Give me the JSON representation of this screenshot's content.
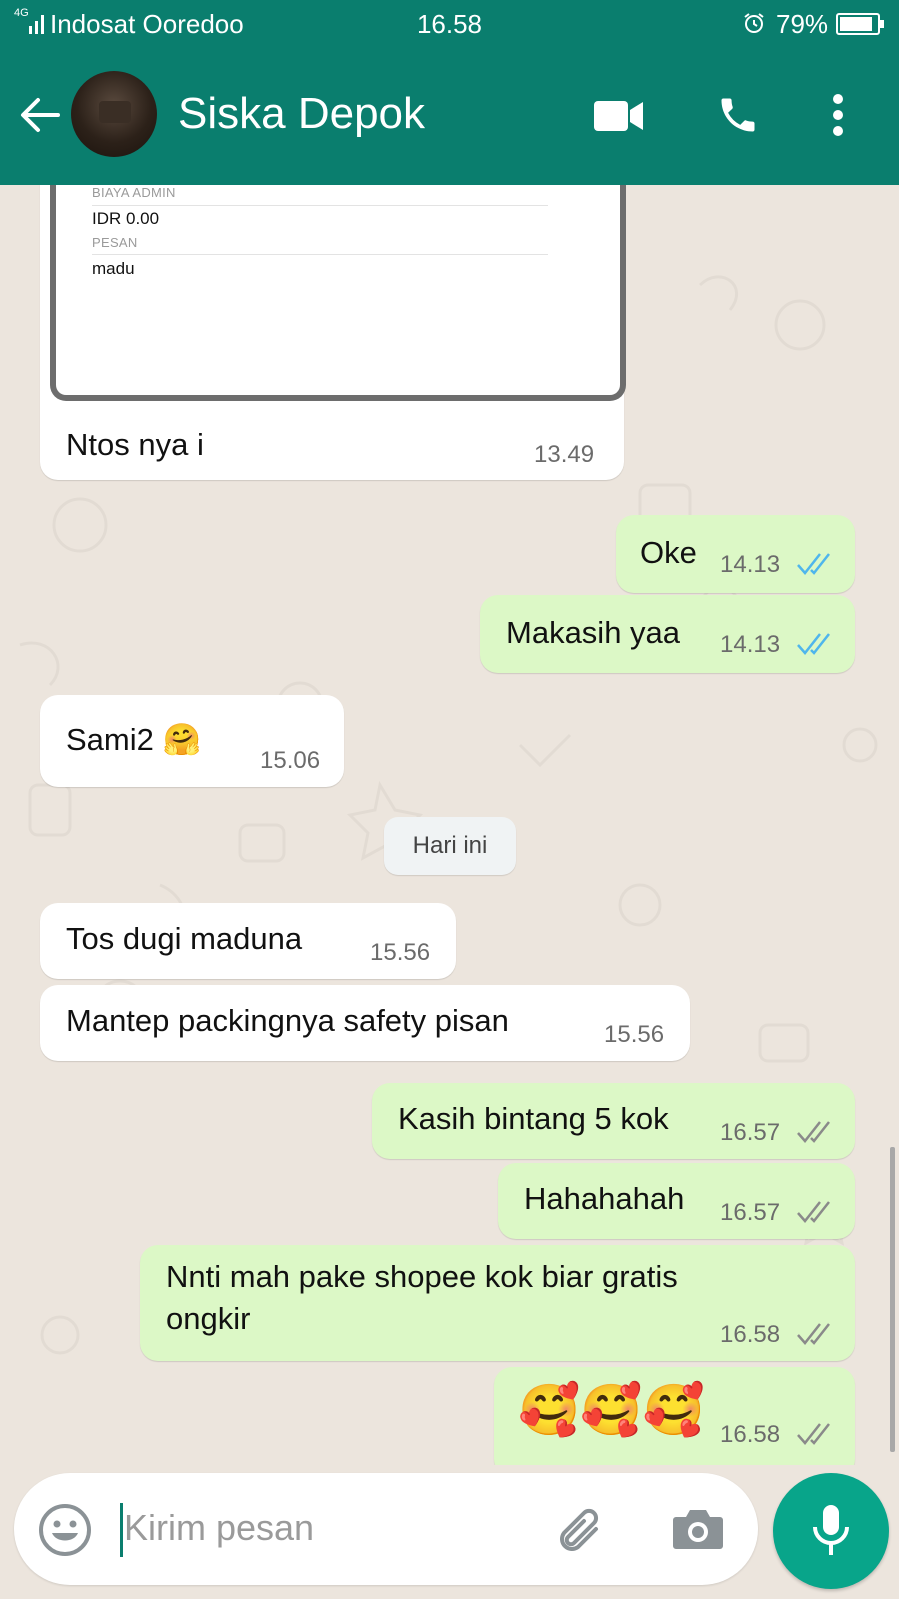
{
  "status_bar": {
    "network_type": "4G",
    "carrier": "Indosat Ooredoo",
    "time": "16.58",
    "battery": "79%"
  },
  "header": {
    "contact_name": "Siska Depok"
  },
  "receipt": {
    "fee_label": "BIAYA ADMIN",
    "fee_value": "IDR 0.00",
    "note_label": "PESAN",
    "note_value": "madu"
  },
  "messages": [
    {
      "text": "Ntos nya i",
      "time": "13.49",
      "direction": "in"
    },
    {
      "text": "Oke",
      "time": "14.13",
      "direction": "out",
      "status": "read"
    },
    {
      "text": "Makasih yaa",
      "time": "14.13",
      "direction": "out",
      "status": "read"
    },
    {
      "text": "Sami2 🤗",
      "time": "15.06",
      "direction": "in"
    },
    {
      "text": "Tos dugi maduna",
      "time": "15.56",
      "direction": "in"
    },
    {
      "text": "Mantep packingnya safety pisan",
      "time": "15.56",
      "direction": "in"
    },
    {
      "text": "Kasih bintang 5 kok",
      "time": "16.57",
      "direction": "out",
      "status": "delivered"
    },
    {
      "text": "Hahahahah",
      "time": "16.57",
      "direction": "out",
      "status": "delivered"
    },
    {
      "text_line1": "Nnti mah pake shopee kok biar gratis",
      "text_line2": "ongkir",
      "time": "16.58",
      "direction": "out",
      "status": "delivered"
    },
    {
      "text": "🥰🥰🥰",
      "time": "16.58",
      "direction": "out",
      "status": "delivered"
    }
  ],
  "day_divider": "Hari ini",
  "composer": {
    "placeholder": "Kirim pesan"
  },
  "colors": {
    "header": "#0a7e6e",
    "chat_background": "#ece5dd",
    "incoming_bubble": "#ffffff",
    "outgoing_bubble": "#dcf8c6",
    "read_tick": "#4fb6ec",
    "delivered_tick": "#8a8a8a",
    "mic_button": "#08a58a"
  },
  "icons": [
    "back-arrow-icon",
    "video-call-icon",
    "phone-icon",
    "more-vert-icon",
    "emoji-icon",
    "attach-icon",
    "camera-icon",
    "mic-icon",
    "double-tick-icon",
    "alarm-icon",
    "battery-icon",
    "signal-icon"
  ]
}
